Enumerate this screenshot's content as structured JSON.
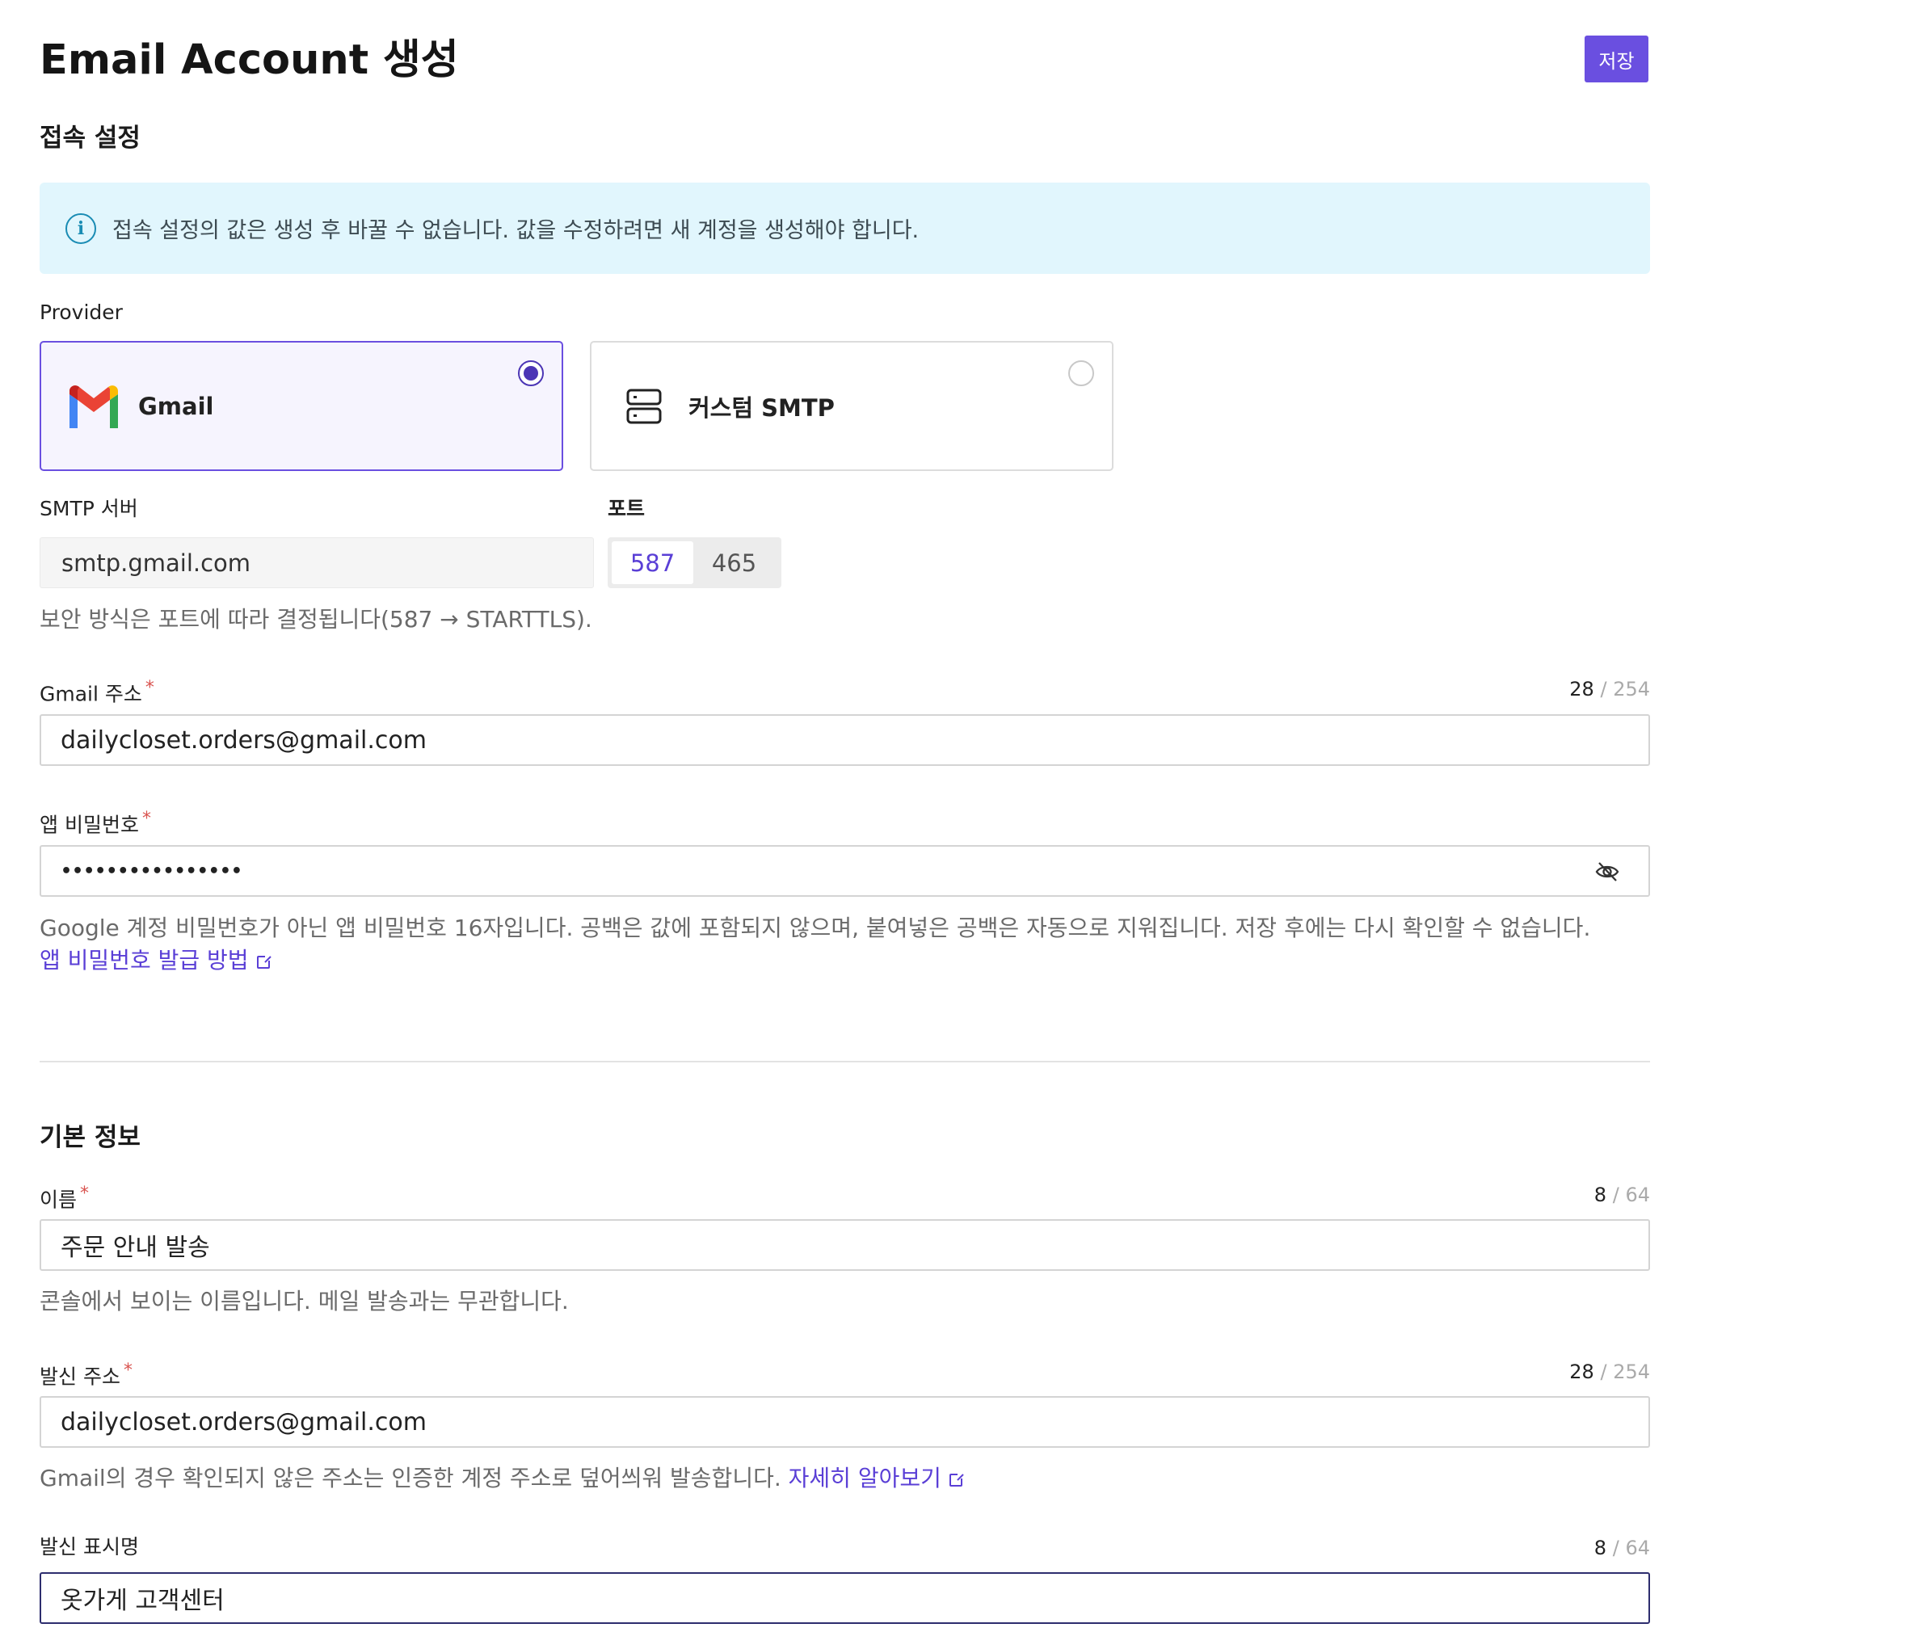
{
  "header": {
    "title": "Email Account 생성",
    "save_label": "저장"
  },
  "connection": {
    "section_title": "접속 설정",
    "notice": "접속 설정의 값은 생성 후 바꿀 수 없습니다. 값을 수정하려면 새 계정을 생성해야 합니다.",
    "provider_label": "Provider",
    "providers": [
      {
        "label": "Gmail",
        "icon": "gmail-logo-icon",
        "selected": true
      },
      {
        "label": "커스텀 SMTP",
        "icon": "server-icon",
        "selected": false
      }
    ],
    "smtp_server_label": "SMTP 서버",
    "smtp_server_value": "smtp.gmail.com",
    "port_label": "포트",
    "port_options": [
      "587",
      "465"
    ],
    "port_selected": "587",
    "security_help": "보안 방식은 포트에 따라 결정됩니다(587 → STARTTLS).",
    "gmail_address": {
      "label": "Gmail 주소",
      "required_mark": "*",
      "count": "28",
      "separator": "/",
      "max": "254",
      "value": "dailycloset.orders@gmail.com"
    },
    "app_password": {
      "label": "앱 비밀번호",
      "required_mark": "*",
      "value_masked": "••••••••••••••••",
      "toggle_icon": "eye-off-icon",
      "help": "Google 계정 비밀번호가 아닌 앱 비밀번호 16자입니다. 공백은 값에 포함되지 않으며, 붙여넣은 공백은 자동으로 지워집니다. 저장 후에는 다시 확인할 수 없습니다.",
      "help_link": "앱 비밀번호 발급 방법"
    }
  },
  "basic": {
    "section_title": "기본 정보",
    "name": {
      "label": "이름",
      "required_mark": "*",
      "count": "8",
      "separator": "/",
      "max": "64",
      "value": "주문 안내 발송",
      "help": "콘솔에서 보이는 이름입니다. 메일 발송과는 무관합니다."
    },
    "sender_address": {
      "label": "발신 주소",
      "required_mark": "*",
      "count": "28",
      "separator": "/",
      "max": "254",
      "value": "dailycloset.orders@gmail.com",
      "help": "Gmail의 경우 확인되지 않은 주소는 인증한 계정 주소로 덮어씌워 발송합니다.",
      "help_link": "자세히 알아보기"
    },
    "sender_display_name": {
      "label": "발신 표시명",
      "count": "8",
      "separator": "/",
      "max": "64",
      "value": "옷가게 고객센터"
    }
  },
  "colors": {
    "accent": "#6a4fe0",
    "notice_bg": "#e1f6fd",
    "required": "#d9534f"
  }
}
